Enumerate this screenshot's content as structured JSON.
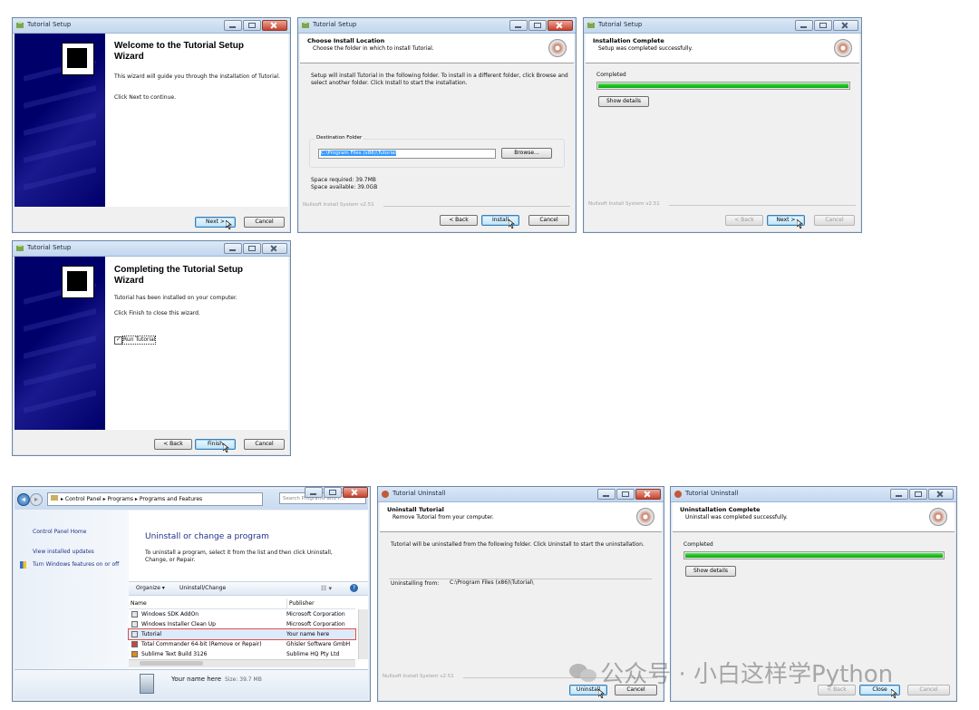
{
  "welcome": {
    "title_bar": "Tutorial Setup",
    "heading": "Welcome to the Tutorial Setup Wizard",
    "line1": "This wizard will guide you through the installation of Tutorial.",
    "line2": "Click Next to continue.",
    "next": "Next >",
    "cancel": "Cancel"
  },
  "location": {
    "title_bar": "Tutorial Setup",
    "header_title": "Choose Install Location",
    "header_sub": "Choose the folder in which to install Tutorial.",
    "instructions": "Setup will install Tutorial in the following folder. To install in a different folder, click Browse and select another folder. Click Install to start the installation.",
    "dest_label": "Destination Folder",
    "dest_value": "C:\\Program Files (x86)\\Tutorial",
    "browse": "Browse...",
    "space_required": "Space required: 39.7MB",
    "space_available": "Space available: 39.0GB",
    "nsis": "Nullsoft Install System v2.51",
    "back": "< Back",
    "install": "Install",
    "cancel": "Cancel"
  },
  "complete": {
    "title_bar": "Tutorial Setup",
    "header_title": "Installation Complete",
    "header_sub": "Setup was completed successfully.",
    "status": "Completed",
    "progress": 1.0,
    "show_details": "Show details",
    "nsis": "Nullsoft Install System v2.51",
    "back": "< Back",
    "next": "Next >",
    "cancel": "Cancel"
  },
  "finish": {
    "title_bar": "Tutorial Setup",
    "heading": "Completing the Tutorial Setup Wizard",
    "line1": "Tutorial has been installed on your computer.",
    "line2": "Click Finish to close this wizard.",
    "run_label": "Run Tutorial",
    "run_checked": true,
    "back": "< Back",
    "finish": "Finish",
    "cancel": "Cancel"
  },
  "control_panel": {
    "breadcrumb": [
      "Control Panel",
      "Programs",
      "Programs and Features"
    ],
    "search_placeholder": "Search Programs and F...",
    "left_links": [
      "Control Panel Home",
      "View installed updates",
      "Turn Windows features on or off"
    ],
    "heading": "Uninstall or change a program",
    "description": "To uninstall a program, select it from the list and then click Uninstall, Change, or Repair.",
    "organize": "Organize ▾",
    "uninstall_change": "Uninstall/Change",
    "col_name": "Name",
    "col_publisher": "Publisher",
    "rows": [
      {
        "name": "Windows SDK AddOn",
        "publisher": "Microsoft Corporation"
      },
      {
        "name": "Windows Installer Clean Up",
        "publisher": "Microsoft Corporation"
      },
      {
        "name": "Tutorial",
        "publisher": "Your name here"
      },
      {
        "name": "Total Commander 64-bit (Remove or Repair)",
        "publisher": "Ghisler Software GmbH"
      },
      {
        "name": "Sublime Text Build 3126",
        "publisher": "Sublime HQ Pty Ltd"
      }
    ],
    "detail_name": "Your name here",
    "detail_size": "Size: 39.7 MB",
    "accent_highlight": "#e0504a"
  },
  "uninstall": {
    "title_bar": "Tutorial Uninstall",
    "header_title": "Uninstall Tutorial",
    "header_sub": "Remove Tutorial from your computer.",
    "instructions": "Tutorial will be uninstalled from the following folder. Click Uninstall to start the uninstallation.",
    "from_label": "Uninstalling from:",
    "from_value": "C:\\Program Files (x86)\\Tutorial\\",
    "nsis": "Nullsoft Install System v2.51",
    "uninstall": "Uninstall",
    "cancel": "Cancel"
  },
  "uninstall_complete": {
    "title_bar": "Tutorial Uninstall",
    "header_title": "Uninstallation Complete",
    "header_sub": "Uninstall was completed successfully.",
    "status": "Completed",
    "progress": 1.0,
    "show_details": "Show details",
    "back": "< Back",
    "close": "Close",
    "cancel": "Cancel"
  },
  "watermark": "公众号 · 小白这样学Python"
}
